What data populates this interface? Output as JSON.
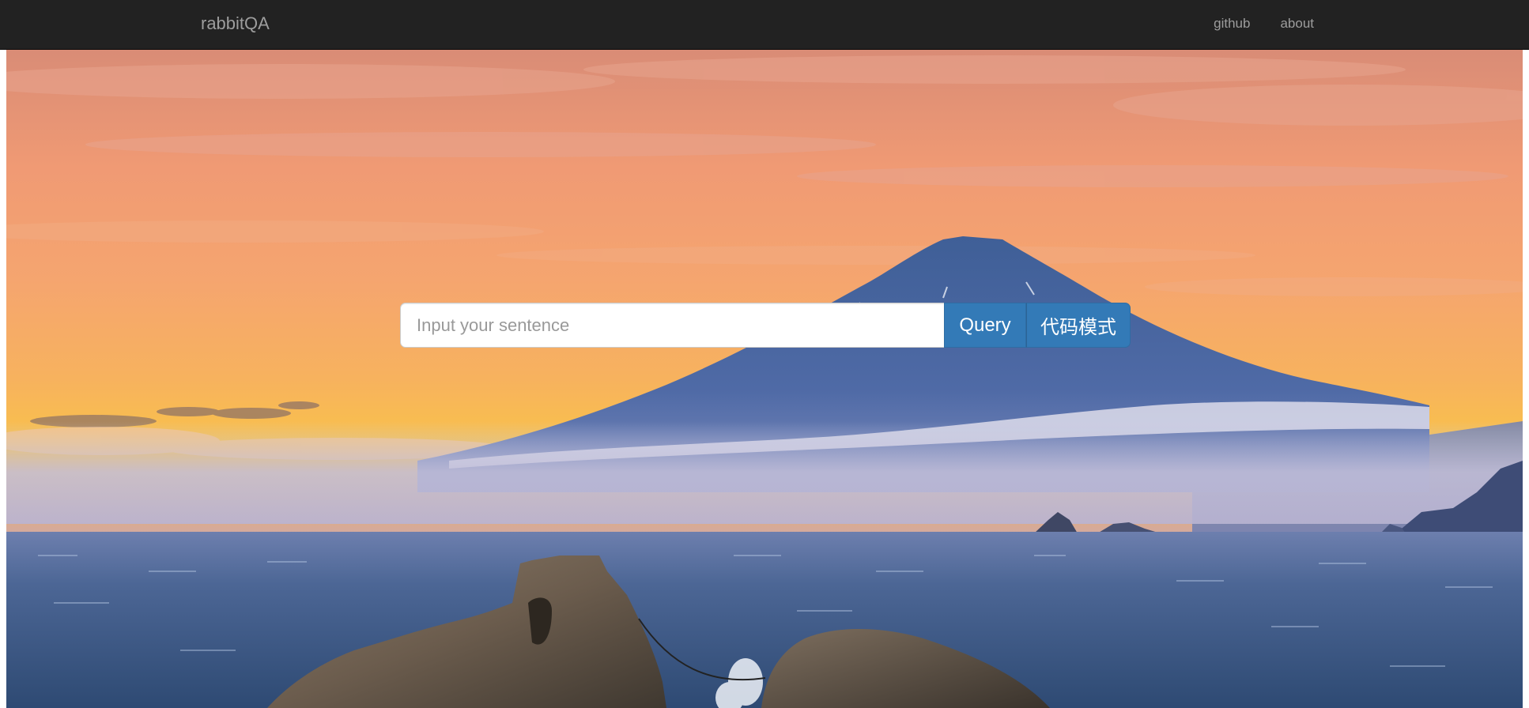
{
  "navbar": {
    "brand": "rabbitQA",
    "links": [
      {
        "label": "github"
      },
      {
        "label": "about"
      }
    ]
  },
  "search": {
    "placeholder": "Input your sentence",
    "value": "",
    "query_label": "Query",
    "code_mode_label": "代码模式"
  },
  "theme": {
    "navbar_bg": "#222222",
    "nav_text": "#9d9d9d",
    "button_primary": "#337ab7"
  }
}
